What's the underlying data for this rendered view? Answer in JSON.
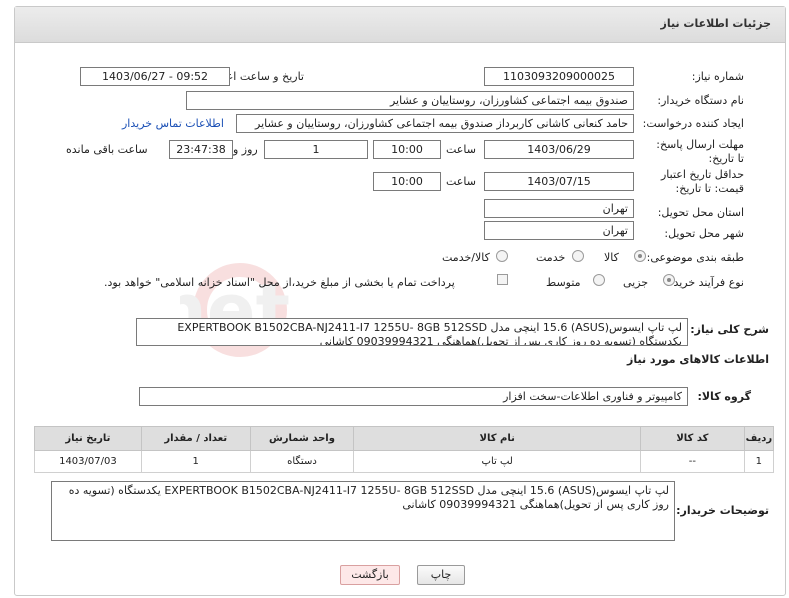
{
  "header": {
    "title": "جزئیات اطلاعات نیاز"
  },
  "form": {
    "need_number_label": "شماره نیاز:",
    "need_number": "1103093209000025",
    "announce_label": "تاریخ و ساعت اعلان عمومی:",
    "announce_value": "1403/06/27 - 09:52",
    "buyer_label": "نام دستگاه خریدار:",
    "buyer_value": "صندوق بیمه اجتماعی کشاورزان، روستاییان و عشایر",
    "creator_label": "ایجاد کننده درخواست:",
    "creator_value": "حامد کنعانی کاشانی کاربرداز صندوق بیمه اجتماعی کشاورزان، روستاییان و عشایر",
    "contact_link": "اطلاعات تماس خریدار",
    "reply_deadline_label": "مهلت ارسال پاسخ: تا تاریخ:",
    "reply_date": "1403/06/29",
    "time_label": "ساعت",
    "reply_time": "10:00",
    "day_label": "روز و",
    "days": "1",
    "remaining_time": "23:47:38",
    "remaining_label": "ساعت باقی مانده",
    "validity_label": "حداقل تاریخ اعتبار قیمت: تا تاریخ:",
    "validity_date": "1403/07/15",
    "validity_time": "10:00",
    "province_label": "استان محل تحویل:",
    "province_value": "تهران",
    "city_label": "شهر محل تحویل:",
    "city_value": "تهران",
    "category_label": "طبقه بندی موضوعی:",
    "category_options": [
      "کالا",
      "خدمت",
      "کالا/خدمت"
    ],
    "category_selected": "کالا",
    "process_label": "نوع فرآیند خرید :",
    "process_options": [
      "جزیی",
      "متوسط"
    ],
    "process_note": "پرداخت تمام یا بخشی از مبلغ خرید،از محل \"اسناد خزانه اسلامی\" خواهد بود."
  },
  "summary": {
    "label": "شرح کلی نیاز:",
    "line1": "لپ تاپ ایسوس(ASUS) 15.6 اینچی مدل EXPERTBOOK B1502CBA-NJ2411-I7 1255U- 8GB 512SSD",
    "line2": "یکدستگاه (تسویه ده روز کاری پس از تحویل)هماهنگی 09039994321 کاشانی"
  },
  "goods": {
    "section_title": "اطلاعات کالاهای مورد نیاز",
    "group_label": "گروه کالا:",
    "group_value": "کامپیوتر و فناوری اطلاعات-سخت افزار",
    "columns": [
      "ردیف",
      "کد کالا",
      "نام کالا",
      "واحد شمارش",
      "تعداد / مقدار",
      "تاریخ نیاز"
    ],
    "rows": [
      {
        "index": "1",
        "code": "--",
        "name": "لپ تاپ",
        "unit": "دستگاه",
        "qty": "1",
        "date": "1403/07/03"
      }
    ]
  },
  "buyer_notes": {
    "label": "توضیحات خریدار:",
    "text": "لپ تاپ ایسوس(ASUS) 15.6 اینچی مدل EXPERTBOOK B1502CBA-NJ2411-I7 1255U- 8GB 512SSD یکدستگاه (تسویه ده روز کاری پس از تحویل)هماهنگی 09039994321 کاشانی"
  },
  "buttons": {
    "print": "چاپ",
    "back": "بازگشت"
  },
  "watermark": {
    "brand": "AriaTender.net"
  }
}
